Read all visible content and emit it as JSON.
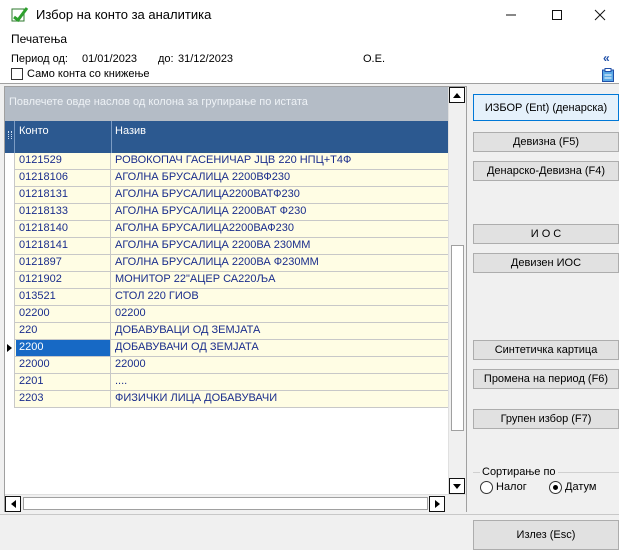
{
  "window": {
    "title": "Избор на конто за аналитика",
    "minimize_icon": "minimize-icon",
    "maximize_icon": "maximize-icon",
    "close_icon": "close-icon"
  },
  "menu": {
    "items": [
      "Печатења"
    ]
  },
  "header": {
    "period_label": "Период од:",
    "period_from": "01/01/2023",
    "to_label": "до:",
    "period_to": "31/12/2023",
    "org": "О.Е.",
    "only_booked_label": "Само конта со книжење",
    "only_booked_checked": false,
    "collapse_icon": "«"
  },
  "grid": {
    "group_panel_text": "Повлечете овде наслов од колона за групирање по истата",
    "columns": [
      "Конто",
      "Назив"
    ],
    "rows": [
      {
        "konto": "0121529",
        "naziv": "РОВОКОПАЧ ГАСЕНИЧАР ЈЦВ 220 НПЦ+Т4Ф"
      },
      {
        "konto": "01218106",
        "naziv": "АГОЛНА БРУСАЛИЦА 2200ВФ230"
      },
      {
        "konto": "01218131",
        "naziv": "АГОЛНА БРУСАЛИЦА2200ВАТФ230"
      },
      {
        "konto": "01218133",
        "naziv": "АГОЛНА БРУСАЛИЦА 2200ВАТ Ф230"
      },
      {
        "konto": "01218140",
        "naziv": "АГОЛНА БРУСАЛИЦА2200ВАФ230"
      },
      {
        "konto": "01218141",
        "naziv": "АГОЛНА БРУСАЛИЦА 2200ВА 230ММ"
      },
      {
        "konto": "0121897",
        "naziv": "АГОЛНА БРУСАЛИЦА 2200ВА Ф230ММ"
      },
      {
        "konto": "0121902",
        "naziv": "МОНИТОР 22\"АЦЕР СА220ЉА"
      },
      {
        "konto": "013521",
        "naziv": "СТОЛ 220 ГИОВ"
      },
      {
        "konto": "02200",
        "naziv": "02200"
      },
      {
        "konto": "220",
        "naziv": "ДОБАВУВАЦИ ОД ЗЕМЈАТА"
      },
      {
        "konto": "2200",
        "naziv": "ДОБАВУВАЧИ ОД ЗЕМЈАТА",
        "selected": true
      },
      {
        "konto": "22000",
        "naziv": "22000"
      },
      {
        "konto": "2201",
        "naziv": "...."
      },
      {
        "konto": "2203",
        "naziv": "ФИЗИЧКИ ЛИЦА ДОБАВУВАЧИ"
      }
    ]
  },
  "buttons": {
    "izbor": "ИЗБОР (Ent) (денарска)",
    "devizna": "Девизна (F5)",
    "denarsko_devizna": "Денарско-Девизна (F4)",
    "ios": "И О С",
    "deviz_ios": "Девизен ИОС",
    "sint_kartica": "Синтетичка картица",
    "promena_period": "Промена на период (F6)",
    "grupen_izbor": "Групен избор (F7)",
    "izlez": "Излез (Esc)"
  },
  "sort": {
    "title": "Сортирање по",
    "options": [
      "Налог",
      "Датум"
    ],
    "selected": "Датум"
  }
}
